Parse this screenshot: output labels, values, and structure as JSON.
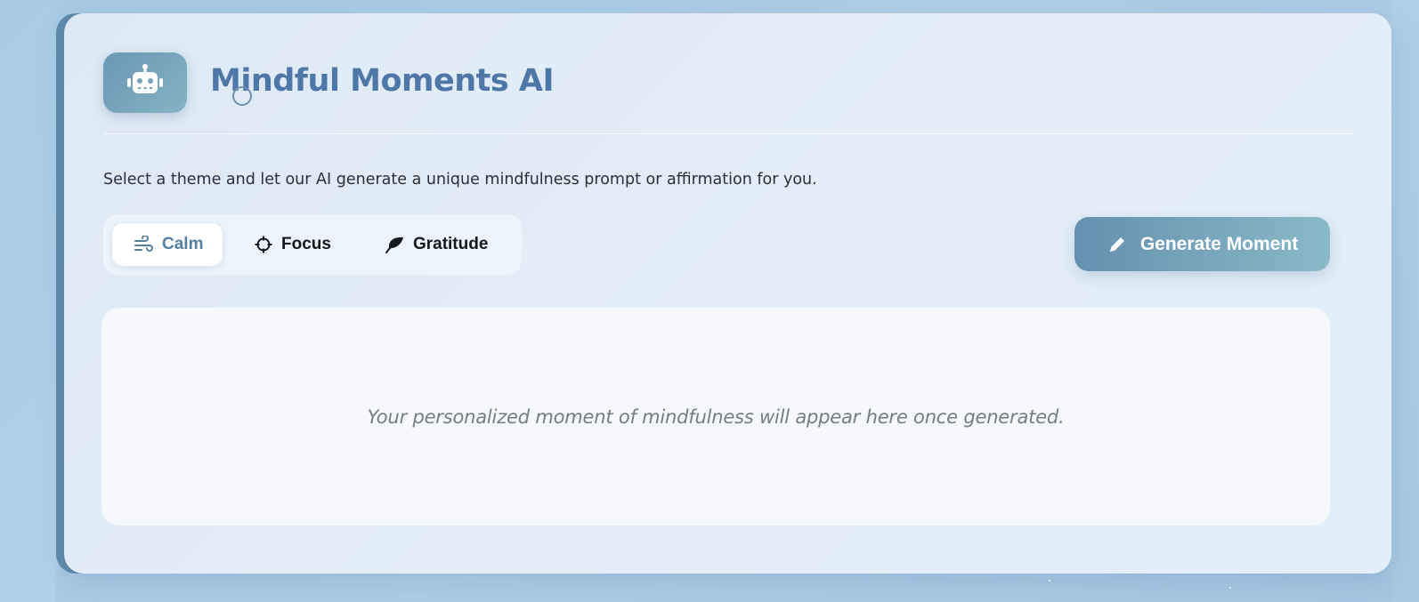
{
  "app": {
    "title": "Mindful Moments AI",
    "logo_icon": "robot-icon"
  },
  "intro": {
    "text": "Select a theme and let our AI generate a unique mindfulness prompt or affirmation for you."
  },
  "themes": {
    "selected": "Calm",
    "items": [
      {
        "label": "Calm",
        "icon": "wind-icon",
        "active": true
      },
      {
        "label": "Focus",
        "icon": "crosshair-icon",
        "active": false
      },
      {
        "label": "Gratitude",
        "icon": "leaf-icon",
        "active": false
      }
    ]
  },
  "generate": {
    "label": "Generate Moment",
    "icon": "pencil-icon"
  },
  "output": {
    "placeholder": "Your personalized moment of mindfulness will appear here once generated."
  },
  "colors": {
    "accent": "#4e76a6",
    "button_gradient_start": "#6690b0",
    "button_gradient_end": "#8ab9c6",
    "active_tab_text": "#547f9f",
    "background": "#a9cbe6"
  }
}
